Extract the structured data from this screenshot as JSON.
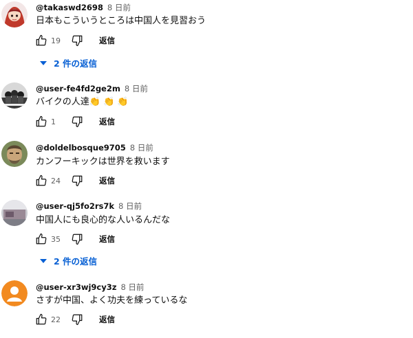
{
  "comments": [
    {
      "author": "@takaswd2698",
      "time": "8 日前",
      "text": "日本もこういうところは中国人を見習おう",
      "likes": "19",
      "reply_label": "返信",
      "replies_label": "2 件の返信"
    },
    {
      "author": "@user-fe4fd2ge2m",
      "time": "8 日前",
      "text": "バイクの人達",
      "emoji": "👏 👏 👏",
      "likes": "1",
      "reply_label": "返信"
    },
    {
      "author": "@doldelbosque9705",
      "time": "8 日前",
      "text": "カンフーキックは世界を救います",
      "likes": "24",
      "reply_label": "返信"
    },
    {
      "author": "@user-qj5fo2rs7k",
      "time": "8 日前",
      "text": "中国人にも良心的な人いるんだな",
      "likes": "35",
      "reply_label": "返信",
      "replies_label": "2 件の返信"
    },
    {
      "author": "@user-xr3wj9cy3z",
      "time": "8 日前",
      "text": "さすが中国、よく功夫を練っているな",
      "likes": "22",
      "reply_label": "返信"
    }
  ],
  "colors": {
    "link_blue": "#065fd4",
    "meta_gray": "#606060",
    "avatar_orange": "#f28a20"
  }
}
